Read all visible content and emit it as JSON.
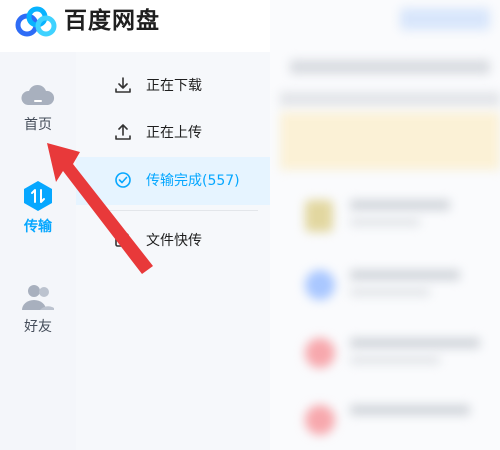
{
  "app": {
    "title": "百度网盘"
  },
  "nav": {
    "items": [
      {
        "label": "首页",
        "icon": "cloud-icon",
        "active": false
      },
      {
        "label": "传输",
        "icon": "transfer-icon",
        "active": true
      },
      {
        "label": "好友",
        "icon": "friends-icon",
        "active": false
      }
    ]
  },
  "transfer": {
    "items": [
      {
        "label": "正在下载",
        "icon": "download-icon"
      },
      {
        "label": "正在上传",
        "icon": "upload-icon"
      },
      {
        "label": "传输完成(557)",
        "icon": "check-circle-icon"
      },
      {
        "label": "文件快传",
        "icon": "quick-send-icon"
      }
    ]
  },
  "colors": {
    "accent": "#06a7ff",
    "annotation": "#e8393a",
    "text": "#1f1f1f"
  }
}
